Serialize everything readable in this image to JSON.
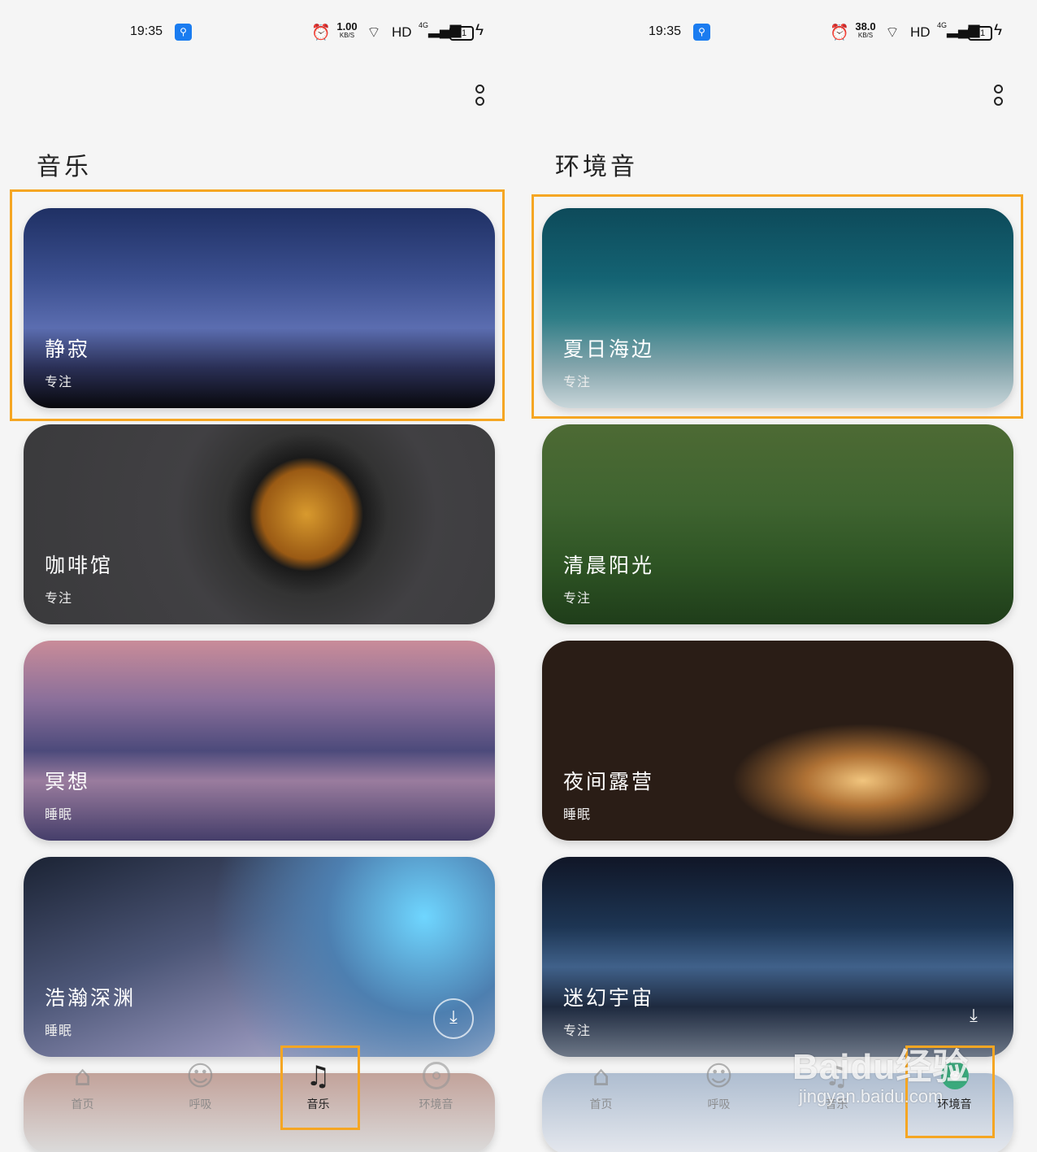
{
  "colors": {
    "highlight": "#f5a623",
    "active_ambient": "#3aa97c",
    "usb_badge": "#1a7cf0"
  },
  "left": {
    "status": {
      "time": "19:35",
      "speed_value": "1.00",
      "speed_unit": "KB/S",
      "network": "HD",
      "signal_gen": "4G",
      "battery": "21"
    },
    "heading": "音乐",
    "cards": [
      {
        "title": "静寂",
        "sub": "专注",
        "download": false
      },
      {
        "title": "咖啡馆",
        "sub": "专注",
        "download": false
      },
      {
        "title": "冥想",
        "sub": "睡眠",
        "download": false
      },
      {
        "title": "浩瀚深渊",
        "sub": "睡眠",
        "download": true
      }
    ],
    "tabs": [
      {
        "label": "首页",
        "icon": "home-icon"
      },
      {
        "label": "呼吸",
        "icon": "smile-icon"
      },
      {
        "label": "音乐",
        "icon": "music-note-icon"
      },
      {
        "label": "环境音",
        "icon": "ambient-icon"
      }
    ],
    "active_tab": "音乐"
  },
  "right": {
    "status": {
      "time": "19:35",
      "speed_value": "38.0",
      "speed_unit": "KB/S",
      "network": "HD",
      "signal_gen": "4G",
      "battery": "21"
    },
    "heading": "环境音",
    "cards": [
      {
        "title": "夏日海边",
        "sub": "专注",
        "download": false
      },
      {
        "title": "清晨阳光",
        "sub": "专注",
        "download": false
      },
      {
        "title": "夜间露营",
        "sub": "睡眠",
        "download": false
      },
      {
        "title": "迷幻宇宙",
        "sub": "专注",
        "download": true
      }
    ],
    "tabs": [
      {
        "label": "首页",
        "icon": "home-icon"
      },
      {
        "label": "呼吸",
        "icon": "smile-icon"
      },
      {
        "label": "音乐",
        "icon": "music-note-icon"
      },
      {
        "label": "环境音",
        "icon": "ambient-icon"
      }
    ],
    "active_tab": "环境音"
  },
  "watermark": {
    "line1": "Baidu经验",
    "line2": "jingyan.baidu.com"
  }
}
